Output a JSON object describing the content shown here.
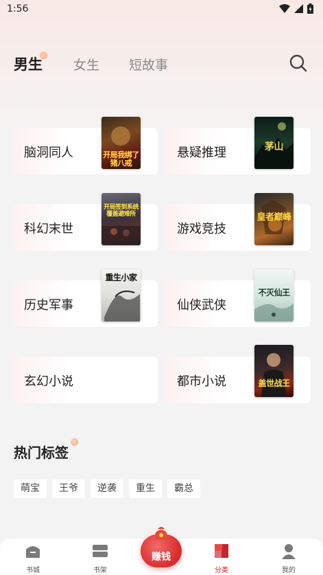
{
  "status_bar": {
    "time": "1:56"
  },
  "top_tabs": [
    {
      "label": "男生",
      "active": true
    },
    {
      "label": "女生",
      "active": false
    },
    {
      "label": "短故事",
      "active": false
    }
  ],
  "categories": [
    {
      "label": "脑洞同人",
      "cover_text": "开局我绑了猪八戒"
    },
    {
      "label": "悬疑推理",
      "cover_text": "茅山"
    },
    {
      "label": "科幻末世",
      "cover_text": "开局签到系统 覆盖避难所"
    },
    {
      "label": "游戏竞技",
      "cover_text": "皇者巅峰"
    },
    {
      "label": "历史军事",
      "cover_text": "重生小家"
    },
    {
      "label": "仙侠武侠",
      "cover_text": "不灭仙王"
    },
    {
      "label": "玄幻小说",
      "cover_text": ""
    },
    {
      "label": "都市小说",
      "cover_text": "盖世战王"
    }
  ],
  "hot_tags": {
    "title": "热门标签",
    "items": [
      "萌宝",
      "王爷",
      "逆袭",
      "重生",
      "霸总"
    ]
  },
  "bottom_nav": {
    "items": [
      {
        "label": "书城",
        "icon": "home-icon",
        "active": false
      },
      {
        "label": "书架",
        "icon": "bookshelf-icon",
        "active": false
      },
      {
        "label": "分类",
        "icon": "category-icon",
        "active": true
      },
      {
        "label": "我的",
        "icon": "profile-icon",
        "active": false
      }
    ],
    "earn_label": "赚钱"
  },
  "colors": {
    "accent": "#c8232c",
    "earn_button": "#d92c2c",
    "tab_dot": "#f6a57d"
  }
}
